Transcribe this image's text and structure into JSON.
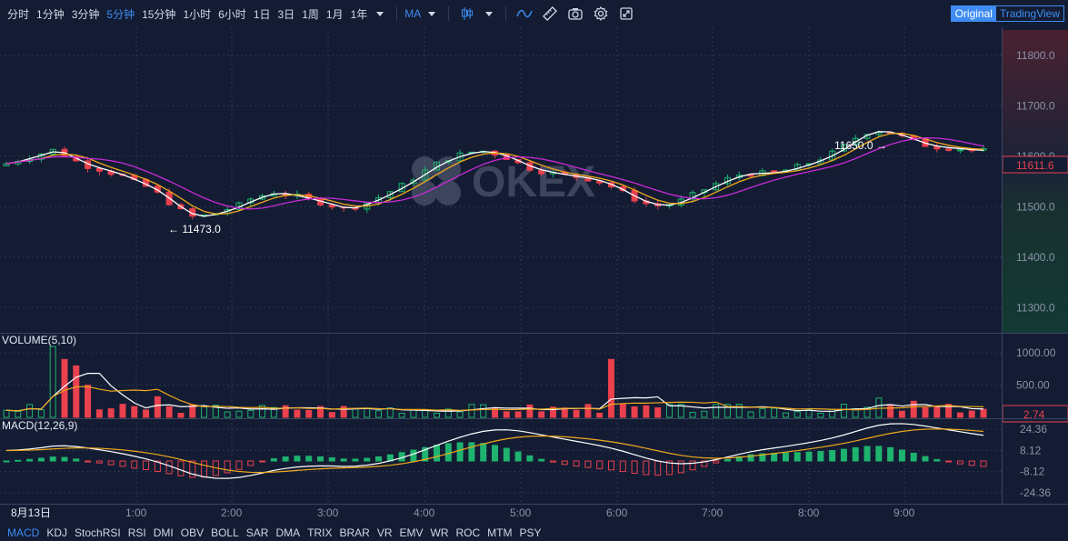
{
  "toolbar": {
    "timeframes": [
      {
        "label": "分时",
        "active": false
      },
      {
        "label": "1分钟",
        "active": false
      },
      {
        "label": "3分钟",
        "active": false
      },
      {
        "label": "5分钟",
        "active": true
      },
      {
        "label": "15分钟",
        "active": false
      },
      {
        "label": "1小时",
        "active": false
      },
      {
        "label": "6小时",
        "active": false
      },
      {
        "label": "1日",
        "active": false
      },
      {
        "label": "3日",
        "active": false
      },
      {
        "label": "1周",
        "active": false
      },
      {
        "label": "1月",
        "active": false
      },
      {
        "label": "1年",
        "active": false
      }
    ],
    "indicator_label": "MA",
    "icons": [
      "candle-type-icon",
      "chevron-down-icon",
      "line-icon",
      "ruler-icon",
      "camera-icon",
      "gear-icon",
      "fullscreen-icon"
    ],
    "original_label": "Original",
    "tradingview_label": "TradingView"
  },
  "watermark": "OKEX",
  "price_axis": {
    "ticks": [
      "11800.0",
      "11700.0",
      "11600.0",
      "11500.0",
      "11400.0",
      "11300.0"
    ],
    "current_price": "11611.6",
    "high_label": "11650.0",
    "low_label": "11473.0"
  },
  "volume_panel": {
    "title": "VOLUME(5,10)",
    "ticks": [
      "1000.00",
      "500.00"
    ],
    "current": "2.74"
  },
  "macd_panel": {
    "title": "MACD(12,26,9)",
    "ticks": [
      "24.36",
      "8.12",
      "-8.12",
      "-24.36"
    ]
  },
  "time_axis": [
    "8月13日",
    "1:00",
    "2:00",
    "3:00",
    "4:00",
    "5:00",
    "6:00",
    "7:00",
    "8:00",
    "9:00"
  ],
  "indicator_bar": [
    "MACD",
    "KDJ",
    "StochRSI",
    "RSI",
    "DMI",
    "OBV",
    "BOLL",
    "SAR",
    "DMA",
    "TRIX",
    "BRAR",
    "VR",
    "EMV",
    "WR",
    "ROC",
    "MTM",
    "PSY"
  ],
  "colors": {
    "background": "#131c33",
    "up": "#1eb36e",
    "down": "#e9414d",
    "accent": "#3e8cf2",
    "ma_white": "#ffffff",
    "ma_yellow": "#f0a91c",
    "ma_purple": "#c92ad8"
  },
  "chart_data": {
    "type": "candlestick",
    "interval": "5分钟",
    "price_range": [
      11250,
      11850
    ],
    "close_path": [
      11585,
      11592,
      11598,
      11605,
      11612,
      11602,
      11590,
      11580,
      11574,
      11567,
      11560,
      11549,
      11540,
      11526,
      11508,
      11492,
      11480,
      11482,
      11487,
      11495,
      11503,
      11515,
      11522,
      11528,
      11524,
      11520,
      11514,
      11508,
      11502,
      11495,
      11500,
      11508,
      11518,
      11530,
      11542,
      11556,
      11571,
      11585,
      11595,
      11603,
      11608,
      11610,
      11605,
      11597,
      11586,
      11576,
      11570,
      11566,
      11562,
      11559,
      11555,
      11549,
      11540,
      11528,
      11515,
      11506,
      11502,
      11504,
      11512,
      11523,
      11534,
      11545,
      11555,
      11563,
      11566,
      11566,
      11568,
      11572,
      11579,
      11586,
      11595,
      11606,
      11620,
      11636,
      11647,
      11650,
      11646,
      11638,
      11630,
      11622,
      11618,
      11616,
      11614,
      11612,
      11611
    ]
  }
}
